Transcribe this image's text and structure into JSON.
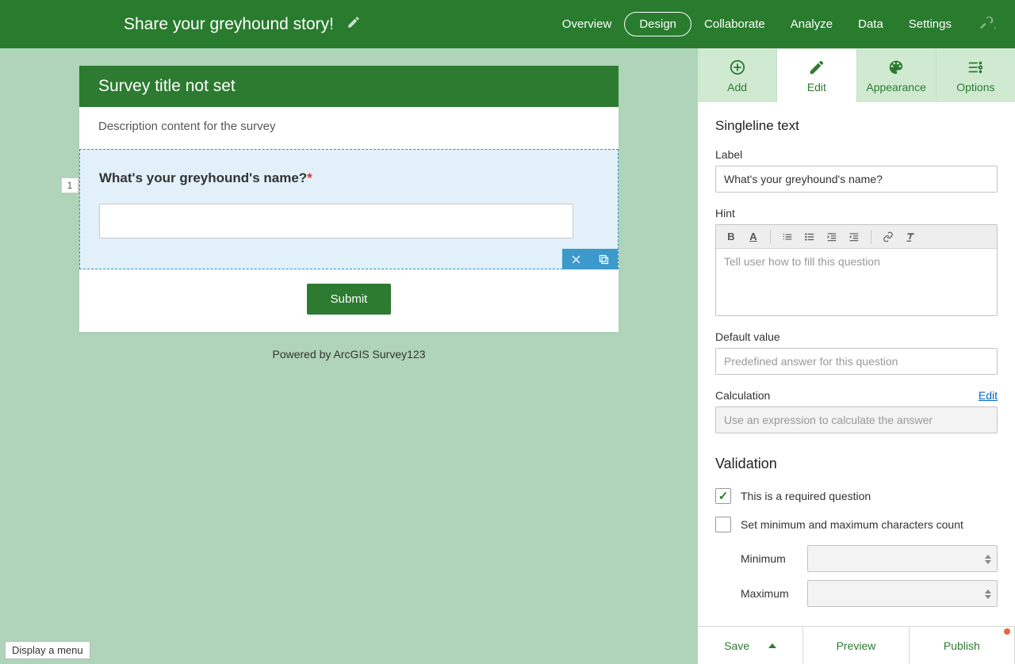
{
  "header": {
    "title": "Share your greyhound story!",
    "nav": [
      "Overview",
      "Design",
      "Collaborate",
      "Analyze",
      "Data",
      "Settings"
    ],
    "active_nav": "Design"
  },
  "survey": {
    "title": "Survey title not set",
    "description": "Description content for the survey",
    "question_number": "1",
    "question_label": "What's your greyhound's name?",
    "submit_label": "Submit",
    "powered": "Powered by ArcGIS Survey123"
  },
  "sidebar": {
    "tabs": [
      "Add",
      "Edit",
      "Appearance",
      "Options"
    ],
    "active_tab": "Edit",
    "section_title": "Singleline text",
    "label_field_label": "Label",
    "label_value": "What's your greyhound's name?",
    "hint_label": "Hint",
    "hint_placeholder": "Tell user how to fill this question",
    "default_label": "Default value",
    "default_placeholder": "Predefined answer for this question",
    "calc_label": "Calculation",
    "calc_edit": "Edit",
    "calc_placeholder": "Use an expression to calculate the answer",
    "validation": {
      "title": "Validation",
      "required_label": "This is a required question",
      "minmax_label": "Set minimum and maximum characters count",
      "min_label": "Minimum",
      "max_label": "Maximum"
    }
  },
  "footer": {
    "save": "Save",
    "preview": "Preview",
    "publish": "Publish"
  },
  "menu_tip": "Display a menu"
}
